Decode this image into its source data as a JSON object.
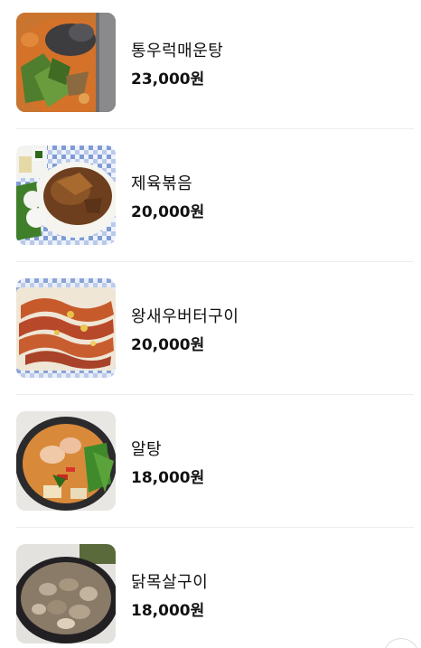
{
  "menu": {
    "items": [
      {
        "name": "통우럭매운탕",
        "price": "23,000원",
        "image_icon": "spicy-rockfish-stew-photo"
      },
      {
        "name": "제육볶음",
        "price": "20,000원",
        "image_icon": "stir-fried-pork-photo"
      },
      {
        "name": "왕새우버터구이",
        "price": "20,000원",
        "image_icon": "butter-grilled-prawns-photo"
      },
      {
        "name": "알탕",
        "price": "18,000원",
        "image_icon": "fish-roe-stew-photo"
      },
      {
        "name": "닭목살구이",
        "price": "18,000원",
        "image_icon": "grilled-chicken-neck-photo"
      }
    ]
  },
  "colors": {
    "text": "#111111",
    "divider": "#ededed",
    "background": "#ffffff"
  }
}
